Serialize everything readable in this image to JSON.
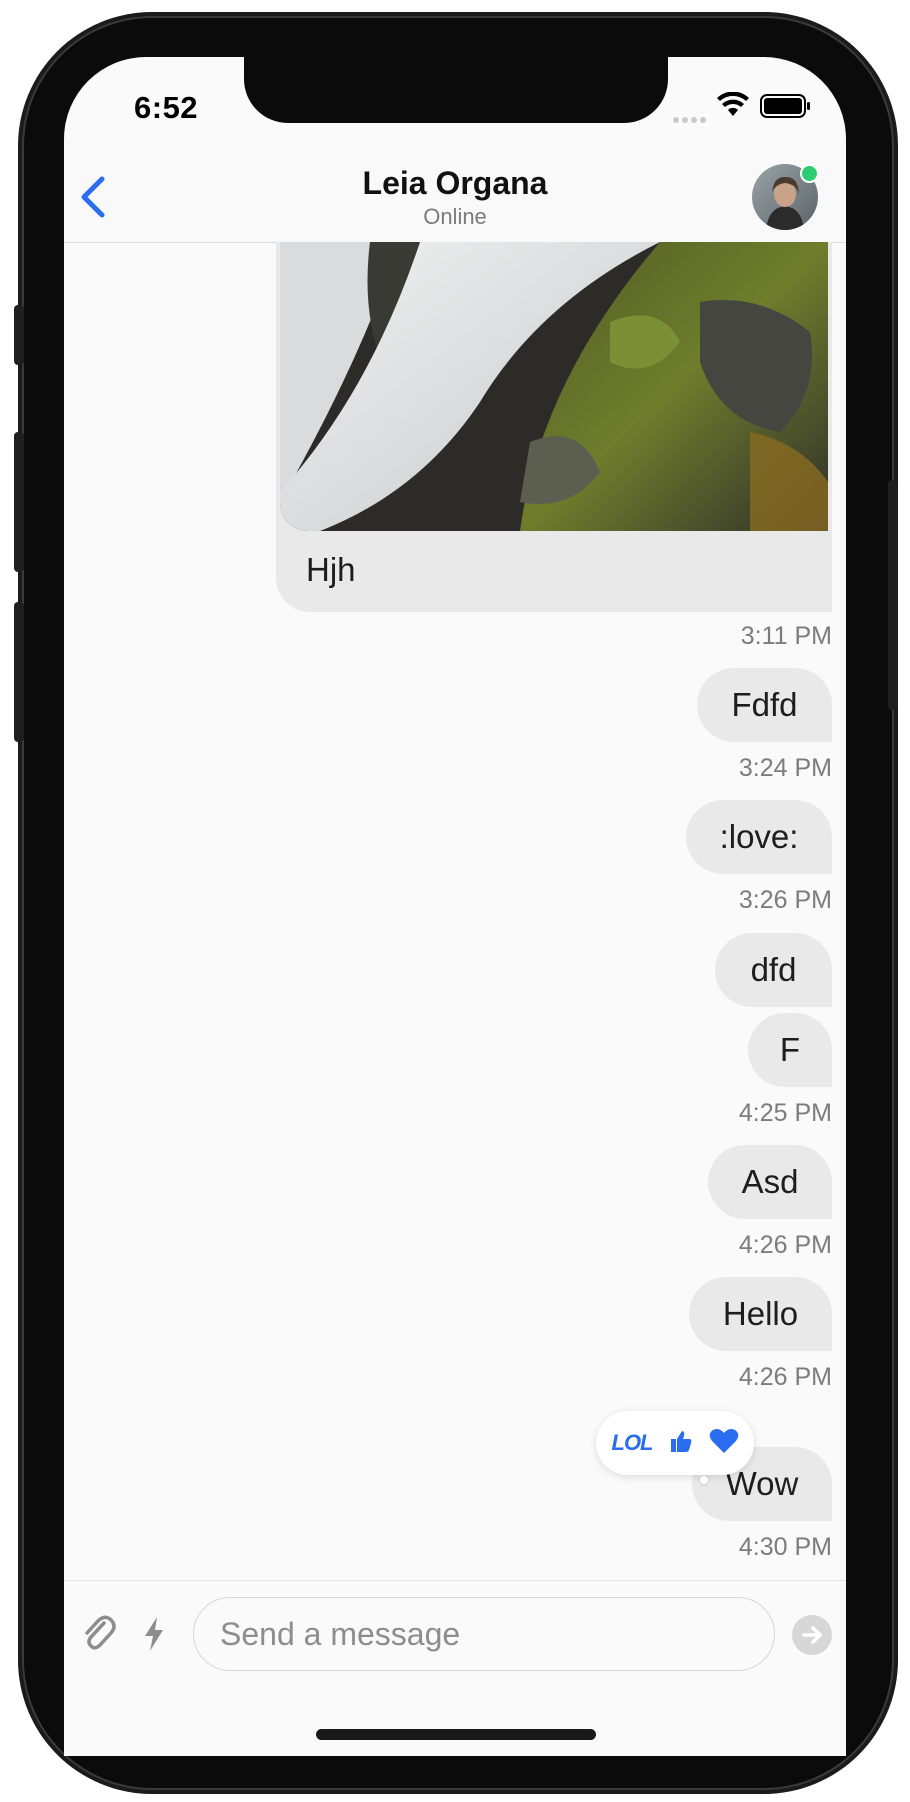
{
  "status_bar": {
    "time": "6:52"
  },
  "header": {
    "contact_name": "Leia Organa",
    "presence": "Online"
  },
  "messages": {
    "image_message": {
      "caption": "Hjh",
      "time": "3:11 PM"
    },
    "list": [
      {
        "text": "Fdfd",
        "time": "3:24 PM"
      },
      {
        "text": ":love:",
        "time": "3:26 PM"
      },
      {
        "text": "dfd"
      },
      {
        "text": "F",
        "time": "4:25 PM"
      },
      {
        "text": "Asd",
        "time": "4:26 PM"
      },
      {
        "text": "Hello",
        "time": "4:26 PM"
      },
      {
        "text": "Wow",
        "time": "4:30 PM"
      }
    ]
  },
  "reactions": {
    "lol_label": "LOL",
    "items": [
      "lol",
      "thumbs-up",
      "heart"
    ]
  },
  "composer": {
    "placeholder": "Send a message"
  },
  "colors": {
    "accent": "#2b6df0",
    "online": "#2ecc71",
    "bubble": "#e9e9e9"
  }
}
